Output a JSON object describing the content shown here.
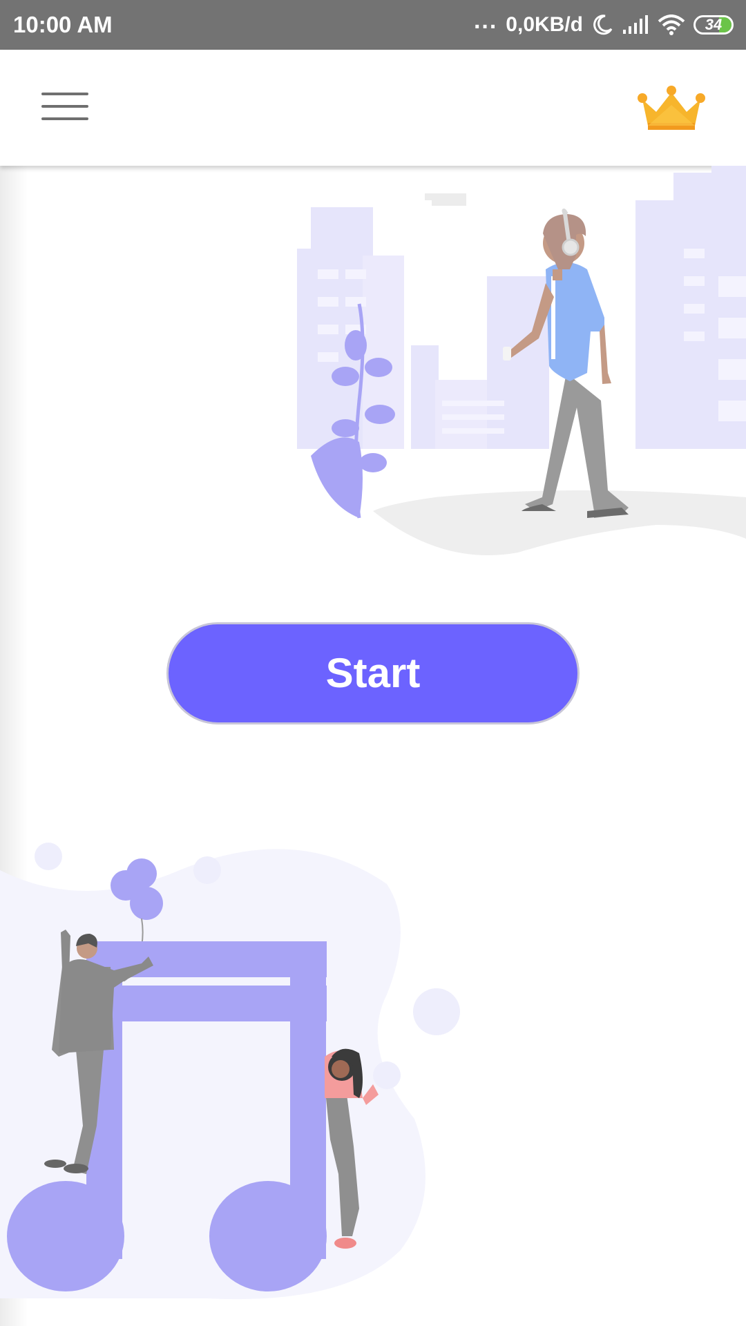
{
  "status_bar": {
    "time": "10:00 AM",
    "overflow": "...",
    "net_speed": "0,0KB/d",
    "battery_level": "34",
    "icons": [
      "moon-icon",
      "signal-icon",
      "wifi-icon",
      "battery-icon"
    ]
  },
  "app_bar": {
    "menu_icon": "hamburger-menu-icon",
    "premium_icon": "crown-icon"
  },
  "main": {
    "start_label": "Start"
  },
  "colors": {
    "status_bar": "#737373",
    "accent": "#6c63ff",
    "illustration_light": "#e6e5fb",
    "illustration_mid": "#a8a4f5",
    "crown": "#f7b52c",
    "battery": "#6bc449"
  }
}
